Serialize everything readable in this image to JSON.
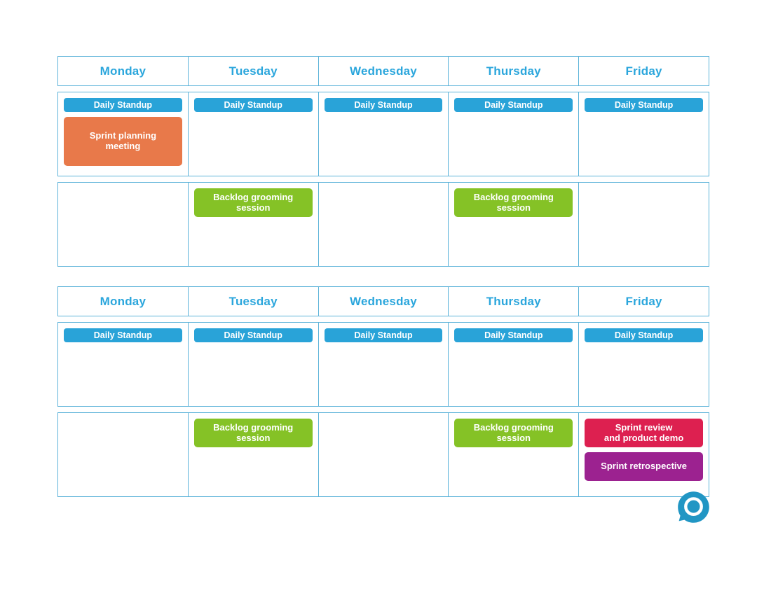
{
  "colors": {
    "border": "#5cb3d9",
    "day_header_text": "#2ba6dc",
    "standup": "#29a3d8",
    "sprint_planning": "#e8794a",
    "backlog_grooming": "#85c226",
    "sprint_review": "#dd2050",
    "sprint_retrospective": "#9c2290",
    "logo": "#2196c4"
  },
  "day_headers": [
    "Monday",
    "Tuesday",
    "Wednesday",
    "Thursday",
    "Friday"
  ],
  "event_labels": {
    "standup": "Daily Standup",
    "sprint_planning": "Sprint planning\nmeeting",
    "backlog_grooming": "Backlog grooming\nsession",
    "sprint_review": "Sprint review\nand product demo",
    "sprint_retrospective": "Sprint retrospective"
  },
  "weeks": [
    {
      "name": "week-1",
      "headers": [
        "Monday",
        "Tuesday",
        "Wednesday",
        "Thursday",
        "Friday"
      ],
      "rows": [
        {
          "name": "week-1-row-1",
          "cells": [
            {
              "day": "Monday",
              "events": [
                {
                  "type": "standup",
                  "label": "Daily Standup"
                },
                {
                  "type": "sprint_planning",
                  "label": "Sprint planning\nmeeting"
                }
              ]
            },
            {
              "day": "Tuesday",
              "events": [
                {
                  "type": "standup",
                  "label": "Daily Standup"
                }
              ]
            },
            {
              "day": "Wednesday",
              "events": [
                {
                  "type": "standup",
                  "label": "Daily Standup"
                }
              ]
            },
            {
              "day": "Thursday",
              "events": [
                {
                  "type": "standup",
                  "label": "Daily Standup"
                }
              ]
            },
            {
              "day": "Friday",
              "events": [
                {
                  "type": "standup",
                  "label": "Daily Standup"
                }
              ]
            }
          ]
        },
        {
          "name": "week-1-row-2",
          "cells": [
            {
              "day": "Monday",
              "events": []
            },
            {
              "day": "Tuesday",
              "events": [
                {
                  "type": "backlog_grooming",
                  "label": "Backlog grooming\nsession"
                }
              ]
            },
            {
              "day": "Wednesday",
              "events": []
            },
            {
              "day": "Thursday",
              "events": [
                {
                  "type": "backlog_grooming",
                  "label": "Backlog grooming\nsession"
                }
              ]
            },
            {
              "day": "Friday",
              "events": []
            }
          ]
        }
      ]
    },
    {
      "name": "week-2",
      "headers": [
        "Monday",
        "Tuesday",
        "Wednesday",
        "Thursday",
        "Friday"
      ],
      "rows": [
        {
          "name": "week-2-row-1",
          "cells": [
            {
              "day": "Monday",
              "events": [
                {
                  "type": "standup",
                  "label": "Daily Standup"
                }
              ]
            },
            {
              "day": "Tuesday",
              "events": [
                {
                  "type": "standup",
                  "label": "Daily Standup"
                }
              ]
            },
            {
              "day": "Wednesday",
              "events": [
                {
                  "type": "standup",
                  "label": "Daily Standup"
                }
              ]
            },
            {
              "day": "Thursday",
              "events": [
                {
                  "type": "standup",
                  "label": "Daily Standup"
                }
              ]
            },
            {
              "day": "Friday",
              "events": [
                {
                  "type": "standup",
                  "label": "Daily Standup"
                }
              ]
            }
          ]
        },
        {
          "name": "week-2-row-2",
          "cells": [
            {
              "day": "Monday",
              "events": []
            },
            {
              "day": "Tuesday",
              "events": [
                {
                  "type": "backlog_grooming",
                  "label": "Backlog grooming\nsession"
                }
              ]
            },
            {
              "day": "Wednesday",
              "events": []
            },
            {
              "day": "Thursday",
              "events": [
                {
                  "type": "backlog_grooming",
                  "label": "Backlog grooming\nsession"
                }
              ]
            },
            {
              "day": "Friday",
              "events": [
                {
                  "type": "sprint_review",
                  "label": "Sprint review\nand product demo"
                },
                {
                  "type": "sprint_retrospective",
                  "label": "Sprint retrospective"
                }
              ]
            }
          ]
        }
      ]
    }
  ],
  "logo": {
    "icon": "circle-ring-logo-icon"
  }
}
